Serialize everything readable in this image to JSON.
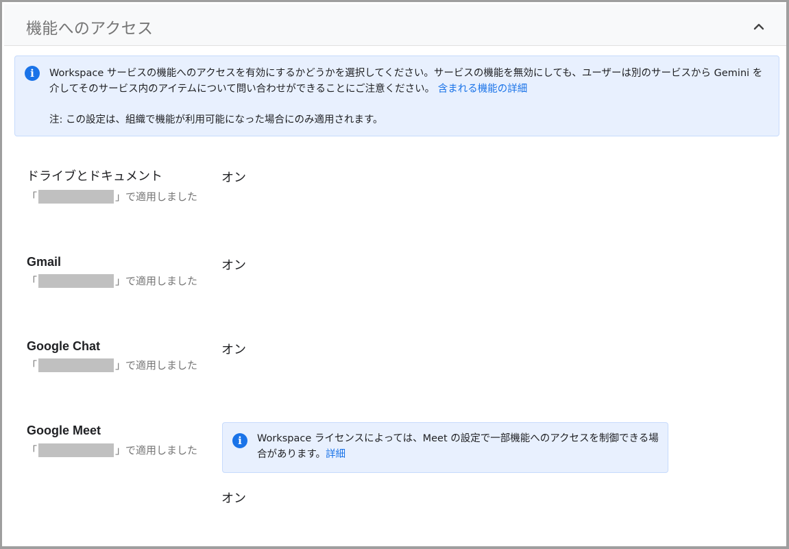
{
  "panel": {
    "title": "機能へのアクセス",
    "collapse_icon": "chevron-up-icon"
  },
  "info": {
    "icon": "info-icon",
    "text": "Workspace サービスの機能へのアクセスを有効にするかどうかを選択してください。サービスの機能を無効にしても、ユーザーは別のサービスから Gemini を介してそのサービス内のアイテムについて問い合わせができることにご注意ください。",
    "link": "含まれる機能の詳細",
    "note": "注: この設定は、組織で機能が利用可能になった場合にのみ適用されます。"
  },
  "services": [
    {
      "name": "ドライブとドキュメント",
      "applied_prefix": "「",
      "applied_suffix": "」で適用しました",
      "status": "オン"
    },
    {
      "name": "Gmail",
      "applied_prefix": "「",
      "applied_suffix": "」で適用しました",
      "status": "オン"
    },
    {
      "name": "Google Chat",
      "applied_prefix": "「",
      "applied_suffix": "」で適用しました",
      "status": "オン"
    },
    {
      "name": "Google Meet",
      "applied_prefix": "「",
      "applied_suffix": "」で適用しました",
      "status": "オン"
    }
  ],
  "meet_info": {
    "icon": "info-icon",
    "text": "Workspace ライセンスによっては、Meet の設定で一部機能へのアクセスを制御できる場合があります。",
    "link": "詳細"
  },
  "colors": {
    "accent": "#1a73e8",
    "info_bg": "#e8f0fe",
    "muted_text": "#757575",
    "redaction": "#c0c0c0"
  }
}
